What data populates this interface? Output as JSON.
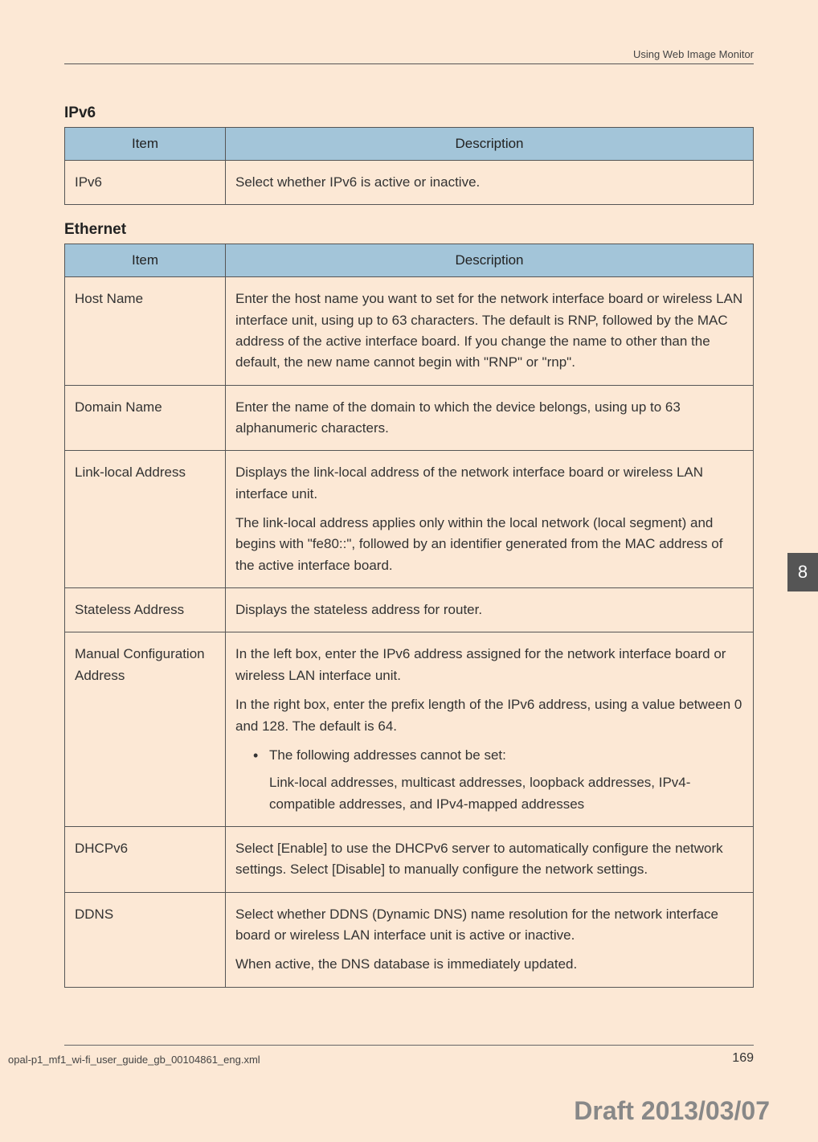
{
  "header": {
    "section_title": "Using Web Image Monitor"
  },
  "sections": {
    "ipv6": {
      "title": "IPv6",
      "headers": {
        "item": "Item",
        "description": "Description"
      },
      "rows": [
        {
          "item": "IPv6",
          "desc": "Select whether IPv6 is active or inactive."
        }
      ]
    },
    "ethernet": {
      "title": "Ethernet",
      "headers": {
        "item": "Item",
        "description": "Description"
      },
      "rows": {
        "host_name": {
          "item": "Host Name",
          "desc": "Enter the host name you want to set for the network interface board or wireless LAN interface unit, using up to 63 characters. The default is RNP, followed by the MAC address of the active interface board. If you change the name to other than the default, the new name cannot begin with \"RNP\" or \"rnp\"."
        },
        "domain_name": {
          "item": "Domain Name",
          "desc": "Enter the name of the domain to which the device belongs, using up to 63 alphanumeric characters."
        },
        "link_local": {
          "item": "Link-local Address",
          "p1": "Displays the link-local address of the network interface board or wireless LAN interface unit.",
          "p2": "The link-local address applies only within the local network (local segment) and begins with \"fe80::\", followed by an identifier generated from the MAC address of the active interface board."
        },
        "stateless": {
          "item": "Stateless Address",
          "desc": "Displays the stateless address for router."
        },
        "manual_config": {
          "item": "Manual Configuration Address",
          "p1": "In the left box, enter the IPv6 address assigned for the network interface board or wireless LAN interface unit.",
          "p2": "In the right box, enter the prefix length of the IPv6 address, using a value between 0 and 128. The default is 64.",
          "bullet": "The following addresses cannot be set:",
          "sub": "Link-local addresses, multicast addresses, loopback addresses, IPv4-compatible addresses, and IPv4-mapped addresses"
        },
        "dhcpv6": {
          "item": "DHCPv6",
          "desc": "Select [Enable] to use the DHCPv6 server to automatically configure the network settings. Select [Disable] to manually configure the network settings."
        },
        "ddns": {
          "item": "DDNS",
          "p1": "Select whether DDNS (Dynamic DNS) name resolution for the network interface board or wireless LAN interface unit is active or inactive.",
          "p2": "When active, the DNS database is immediately updated."
        }
      }
    }
  },
  "side_tab": "8",
  "footer": {
    "file": "opal-p1_mf1_wi-fi_user_guide_gb_00104861_eng.xml",
    "page": "169",
    "draft": "Draft 2013/03/07"
  }
}
